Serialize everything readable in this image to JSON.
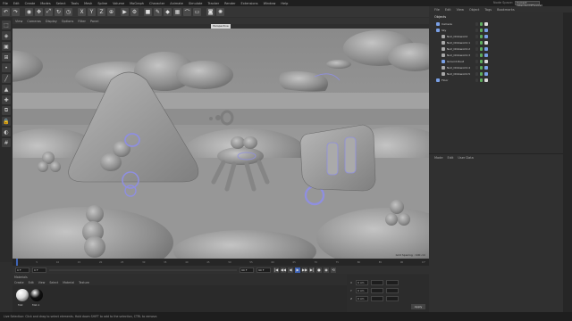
{
  "menubar": {
    "items": [
      "File",
      "Edit",
      "Create",
      "Modes",
      "Select",
      "Tools",
      "Mesh",
      "Spline",
      "Volume",
      "MoGraph",
      "Character",
      "Animate",
      "Simulate",
      "Tracker",
      "Render",
      "Extensions",
      "Window",
      "Help"
    ],
    "layout_label": "Node Space:",
    "layout_value": "Current (Standard/Physical)",
    "layout_right": "Layout:"
  },
  "toolbar": {
    "icons": [
      "undo-icon",
      "redo-icon",
      "live-select-icon",
      "move-icon",
      "scale-icon",
      "rotate-icon",
      "recent-icon",
      "x-axis-icon",
      "y-axis-icon",
      "z-axis-icon",
      "coordinate-icon",
      "render-view-icon",
      "render-settings-icon",
      "cube-icon",
      "pen-icon",
      "subdivision-icon",
      "array-icon",
      "bend-icon",
      "floor-icon",
      "camera-icon",
      "light-icon"
    ],
    "glyphs": [
      "↶",
      "↷",
      "◉",
      "✥",
      "⤢",
      "↻",
      "◷",
      "X",
      "Y",
      "Z",
      "⊕",
      "▶",
      "⚙",
      "■",
      "✎",
      "◆",
      "▦",
      "⌒",
      "▭",
      "◙",
      "✺"
    ]
  },
  "leftbar": {
    "icons": [
      "make-editable-icon",
      "model-mode-icon",
      "texture-mode-icon",
      "workplane-icon",
      "points-mode-icon",
      "edges-mode-icon",
      "polygons-mode-icon",
      "axis-icon",
      "snap-icon",
      "lock-icon",
      "solo-icon",
      "grid-icon"
    ],
    "glyphs": [
      "⬚",
      "◈",
      "▣",
      "⊞",
      "•",
      "╱",
      "▲",
      "✚",
      "⧉",
      "🔒",
      "◐",
      "#"
    ]
  },
  "viewport": {
    "menu": [
      "View",
      "Cameras",
      "Display",
      "Options",
      "Filter",
      "Panel"
    ],
    "tab": "Perspective",
    "readout": "Grid Spacing : 100 cm"
  },
  "timeline": {
    "ticks": [
      "0",
      "5",
      "10",
      "15",
      "20",
      "25",
      "30",
      "35",
      "40",
      "45",
      "50",
      "55",
      "60",
      "65",
      "70",
      "75",
      "80",
      "85",
      "90",
      "0 F"
    ],
    "start_field": "0 F",
    "current_field": "0 F",
    "end_field": "90 F",
    "end2_field": "90 F",
    "buttons": [
      "|◀",
      "◀◀",
      "◀",
      "▶",
      "▶▶",
      "▶|",
      "●",
      "◉",
      "⟲"
    ],
    "playhead_fraction": 0.0
  },
  "materials": {
    "header": [
      "Materials"
    ],
    "menu": [
      "Create",
      "Edit",
      "View",
      "Select",
      "Material",
      "Texture"
    ],
    "items": [
      {
        "name": "Mat",
        "color": "#d8d8d8"
      },
      {
        "name": "Mat.1",
        "color": "#111111"
      }
    ]
  },
  "coordinates": {
    "rows": [
      "X",
      "Y",
      "Z"
    ],
    "values": [
      "0 cm",
      "0 cm",
      "0 cm"
    ],
    "apply": "Apply"
  },
  "right_panel": {
    "menu": [
      "File",
      "Edit",
      "View",
      "Object",
      "Tags",
      "Bookmarks"
    ],
    "tree_header": "Objects",
    "tree": [
      {
        "label": "Camera",
        "indent": 0,
        "color": "#7aa0e6"
      },
      {
        "label": "Sky",
        "indent": 0,
        "color": "#7aa0e6"
      },
      {
        "label": "Null_Chibiworld",
        "indent": 1,
        "color": "#a8a8a8"
      },
      {
        "label": "Null_Chibiworld.1",
        "indent": 1,
        "color": "#a8a8a8"
      },
      {
        "label": "Null_Chibiworld.2",
        "indent": 1,
        "color": "#a8a8a8"
      },
      {
        "label": "Null_Chibiworld.3",
        "indent": 1,
        "color": "#a8a8a8"
      },
      {
        "label": "Ground.Dust",
        "indent": 1,
        "color": "#7aa0e6"
      },
      {
        "label": "Null_Chibiworld.4",
        "indent": 1,
        "color": "#a8a8a8"
      },
      {
        "label": "Null_Chibiworld.5",
        "indent": 1,
        "color": "#a8a8a8"
      },
      {
        "label": "Floor",
        "indent": 0,
        "color": "#7aa0e6"
      }
    ],
    "attr_menu": [
      "Mode",
      "Edit",
      "User Data"
    ]
  },
  "status": {
    "text": "Live Selection: Click and drag to select elements. Hold down SHIFT to add to the selection, CTRL to remove."
  },
  "colors": {
    "accent": "#3f64b6",
    "viewport_bg": "#9a9a9a",
    "selection_outline": "#8f8fe0"
  }
}
